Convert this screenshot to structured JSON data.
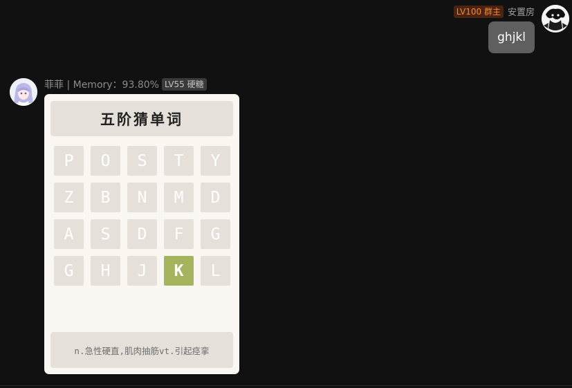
{
  "messages": [
    {
      "sender": "安置房",
      "badge": "LV100 群主",
      "text": "ghjkl"
    }
  ],
  "bot": {
    "sender": "菲菲 | Memory：93.80%",
    "badge": "LV55 硬糖"
  },
  "game": {
    "title": "五阶猜单词",
    "rows": [
      [
        {
          "letter": "P",
          "state": "miss"
        },
        {
          "letter": "O",
          "state": "miss"
        },
        {
          "letter": "S",
          "state": "miss"
        },
        {
          "letter": "T",
          "state": "miss"
        },
        {
          "letter": "Y",
          "state": "miss"
        }
      ],
      [
        {
          "letter": "Z",
          "state": "miss"
        },
        {
          "letter": "B",
          "state": "miss"
        },
        {
          "letter": "N",
          "state": "miss"
        },
        {
          "letter": "M",
          "state": "miss"
        },
        {
          "letter": "D",
          "state": "miss"
        }
      ],
      [
        {
          "letter": "A",
          "state": "miss"
        },
        {
          "letter": "S",
          "state": "miss"
        },
        {
          "letter": "D",
          "state": "miss"
        },
        {
          "letter": "F",
          "state": "miss"
        },
        {
          "letter": "G",
          "state": "miss"
        }
      ],
      [
        {
          "letter": "G",
          "state": "miss"
        },
        {
          "letter": "H",
          "state": "miss"
        },
        {
          "letter": "J",
          "state": "miss"
        },
        {
          "letter": "K",
          "state": "hit"
        },
        {
          "letter": "L",
          "state": "miss"
        }
      ]
    ],
    "hint": "n.急性硬直,肌肉抽筋vt.引起痉挛"
  },
  "colors": {
    "background": "#111111",
    "hit_tile": "#a5b35c",
    "miss_tile": "#e5e0da"
  }
}
